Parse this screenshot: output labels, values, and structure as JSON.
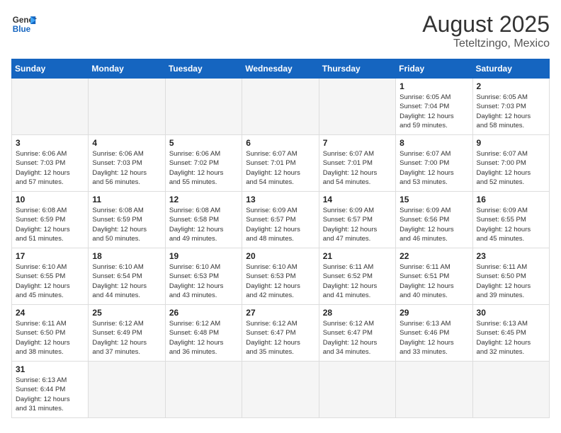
{
  "header": {
    "logo_general": "General",
    "logo_blue": "Blue",
    "month_year": "August 2025",
    "location": "Teteltzingo, Mexico"
  },
  "weekdays": [
    "Sunday",
    "Monday",
    "Tuesday",
    "Wednesday",
    "Thursday",
    "Friday",
    "Saturday"
  ],
  "weeks": [
    [
      {
        "day": "",
        "info": ""
      },
      {
        "day": "",
        "info": ""
      },
      {
        "day": "",
        "info": ""
      },
      {
        "day": "",
        "info": ""
      },
      {
        "day": "",
        "info": ""
      },
      {
        "day": "1",
        "info": "Sunrise: 6:05 AM\nSunset: 7:04 PM\nDaylight: 12 hours\nand 59 minutes."
      },
      {
        "day": "2",
        "info": "Sunrise: 6:05 AM\nSunset: 7:03 PM\nDaylight: 12 hours\nand 58 minutes."
      }
    ],
    [
      {
        "day": "3",
        "info": "Sunrise: 6:06 AM\nSunset: 7:03 PM\nDaylight: 12 hours\nand 57 minutes."
      },
      {
        "day": "4",
        "info": "Sunrise: 6:06 AM\nSunset: 7:03 PM\nDaylight: 12 hours\nand 56 minutes."
      },
      {
        "day": "5",
        "info": "Sunrise: 6:06 AM\nSunset: 7:02 PM\nDaylight: 12 hours\nand 55 minutes."
      },
      {
        "day": "6",
        "info": "Sunrise: 6:07 AM\nSunset: 7:01 PM\nDaylight: 12 hours\nand 54 minutes."
      },
      {
        "day": "7",
        "info": "Sunrise: 6:07 AM\nSunset: 7:01 PM\nDaylight: 12 hours\nand 54 minutes."
      },
      {
        "day": "8",
        "info": "Sunrise: 6:07 AM\nSunset: 7:00 PM\nDaylight: 12 hours\nand 53 minutes."
      },
      {
        "day": "9",
        "info": "Sunrise: 6:07 AM\nSunset: 7:00 PM\nDaylight: 12 hours\nand 52 minutes."
      }
    ],
    [
      {
        "day": "10",
        "info": "Sunrise: 6:08 AM\nSunset: 6:59 PM\nDaylight: 12 hours\nand 51 minutes."
      },
      {
        "day": "11",
        "info": "Sunrise: 6:08 AM\nSunset: 6:59 PM\nDaylight: 12 hours\nand 50 minutes."
      },
      {
        "day": "12",
        "info": "Sunrise: 6:08 AM\nSunset: 6:58 PM\nDaylight: 12 hours\nand 49 minutes."
      },
      {
        "day": "13",
        "info": "Sunrise: 6:09 AM\nSunset: 6:57 PM\nDaylight: 12 hours\nand 48 minutes."
      },
      {
        "day": "14",
        "info": "Sunrise: 6:09 AM\nSunset: 6:57 PM\nDaylight: 12 hours\nand 47 minutes."
      },
      {
        "day": "15",
        "info": "Sunrise: 6:09 AM\nSunset: 6:56 PM\nDaylight: 12 hours\nand 46 minutes."
      },
      {
        "day": "16",
        "info": "Sunrise: 6:09 AM\nSunset: 6:55 PM\nDaylight: 12 hours\nand 45 minutes."
      }
    ],
    [
      {
        "day": "17",
        "info": "Sunrise: 6:10 AM\nSunset: 6:55 PM\nDaylight: 12 hours\nand 45 minutes."
      },
      {
        "day": "18",
        "info": "Sunrise: 6:10 AM\nSunset: 6:54 PM\nDaylight: 12 hours\nand 44 minutes."
      },
      {
        "day": "19",
        "info": "Sunrise: 6:10 AM\nSunset: 6:53 PM\nDaylight: 12 hours\nand 43 minutes."
      },
      {
        "day": "20",
        "info": "Sunrise: 6:10 AM\nSunset: 6:53 PM\nDaylight: 12 hours\nand 42 minutes."
      },
      {
        "day": "21",
        "info": "Sunrise: 6:11 AM\nSunset: 6:52 PM\nDaylight: 12 hours\nand 41 minutes."
      },
      {
        "day": "22",
        "info": "Sunrise: 6:11 AM\nSunset: 6:51 PM\nDaylight: 12 hours\nand 40 minutes."
      },
      {
        "day": "23",
        "info": "Sunrise: 6:11 AM\nSunset: 6:50 PM\nDaylight: 12 hours\nand 39 minutes."
      }
    ],
    [
      {
        "day": "24",
        "info": "Sunrise: 6:11 AM\nSunset: 6:50 PM\nDaylight: 12 hours\nand 38 minutes."
      },
      {
        "day": "25",
        "info": "Sunrise: 6:12 AM\nSunset: 6:49 PM\nDaylight: 12 hours\nand 37 minutes."
      },
      {
        "day": "26",
        "info": "Sunrise: 6:12 AM\nSunset: 6:48 PM\nDaylight: 12 hours\nand 36 minutes."
      },
      {
        "day": "27",
        "info": "Sunrise: 6:12 AM\nSunset: 6:47 PM\nDaylight: 12 hours\nand 35 minutes."
      },
      {
        "day": "28",
        "info": "Sunrise: 6:12 AM\nSunset: 6:47 PM\nDaylight: 12 hours\nand 34 minutes."
      },
      {
        "day": "29",
        "info": "Sunrise: 6:13 AM\nSunset: 6:46 PM\nDaylight: 12 hours\nand 33 minutes."
      },
      {
        "day": "30",
        "info": "Sunrise: 6:13 AM\nSunset: 6:45 PM\nDaylight: 12 hours\nand 32 minutes."
      }
    ],
    [
      {
        "day": "31",
        "info": "Sunrise: 6:13 AM\nSunset: 6:44 PM\nDaylight: 12 hours\nand 31 minutes."
      },
      {
        "day": "",
        "info": ""
      },
      {
        "day": "",
        "info": ""
      },
      {
        "day": "",
        "info": ""
      },
      {
        "day": "",
        "info": ""
      },
      {
        "day": "",
        "info": ""
      },
      {
        "day": "",
        "info": ""
      }
    ]
  ]
}
